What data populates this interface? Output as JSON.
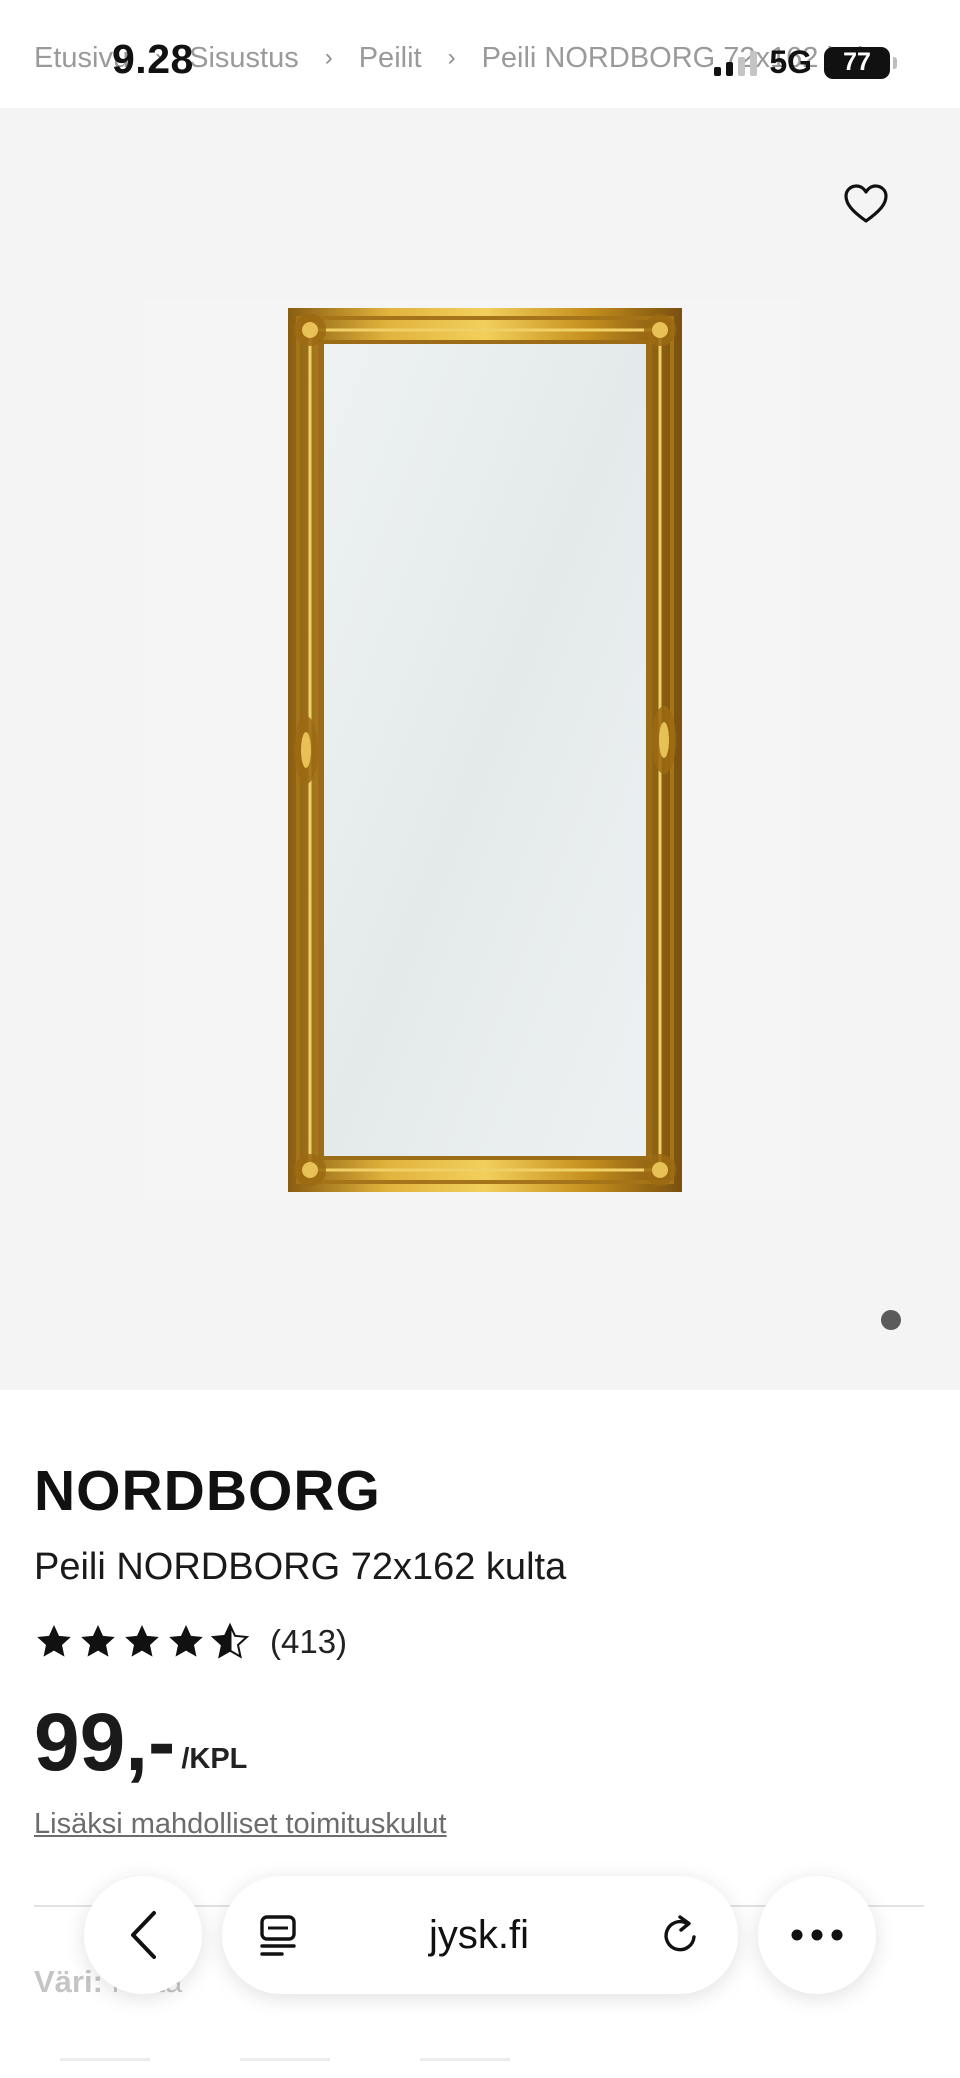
{
  "status_bar": {
    "time": "9.28",
    "network": "5G",
    "battery": "77"
  },
  "breadcrumb": [
    "Etusivu",
    "Sisustus",
    "Peilit",
    "Peili NORDBORG 72x162 kulta"
  ],
  "product": {
    "brand": "NORDBORG",
    "name": "Peili NORDBORG 72x162 kulta",
    "rating": 4.5,
    "rating_max": 5,
    "review_count": "(413)",
    "price": "99,-",
    "price_unit": "/KPL",
    "shipping_note": "Lisäksi mahdolliset toimituskulut",
    "color_label": "Väri:",
    "color_value": "Kulta"
  },
  "gallery": {
    "image_count": 1,
    "active_image": 1
  },
  "browser": {
    "url": "jysk.fi"
  },
  "colors": {
    "accent_gold": "#c9962a",
    "text": "#1a1a1a"
  }
}
